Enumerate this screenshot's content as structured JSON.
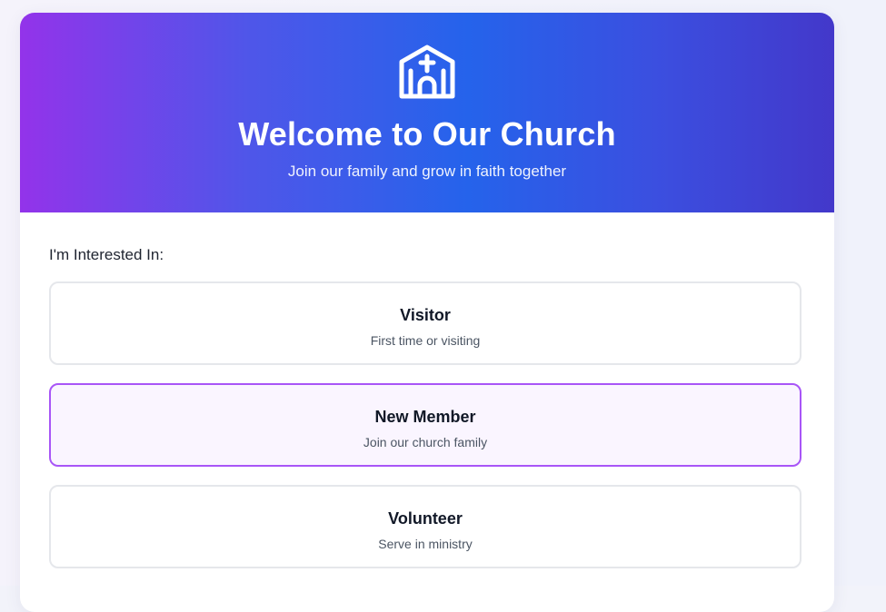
{
  "hero": {
    "icon": "church-icon",
    "title": "Welcome to Our Church",
    "subtitle": "Join our family and grow in faith together",
    "gradient_colors": [
      "#9333ea",
      "#2563eb",
      "#4338ca"
    ]
  },
  "form": {
    "section_label": "I'm Interested In:",
    "options": [
      {
        "title": "Visitor",
        "description": "First time or visiting",
        "selected": false
      },
      {
        "title": "New Member",
        "description": "Join our church family",
        "selected": true
      },
      {
        "title": "Volunteer",
        "description": "Serve in ministry",
        "selected": false
      }
    ],
    "selected_border_color": "#a855f7",
    "selected_bg_color": "#faf5ff"
  }
}
